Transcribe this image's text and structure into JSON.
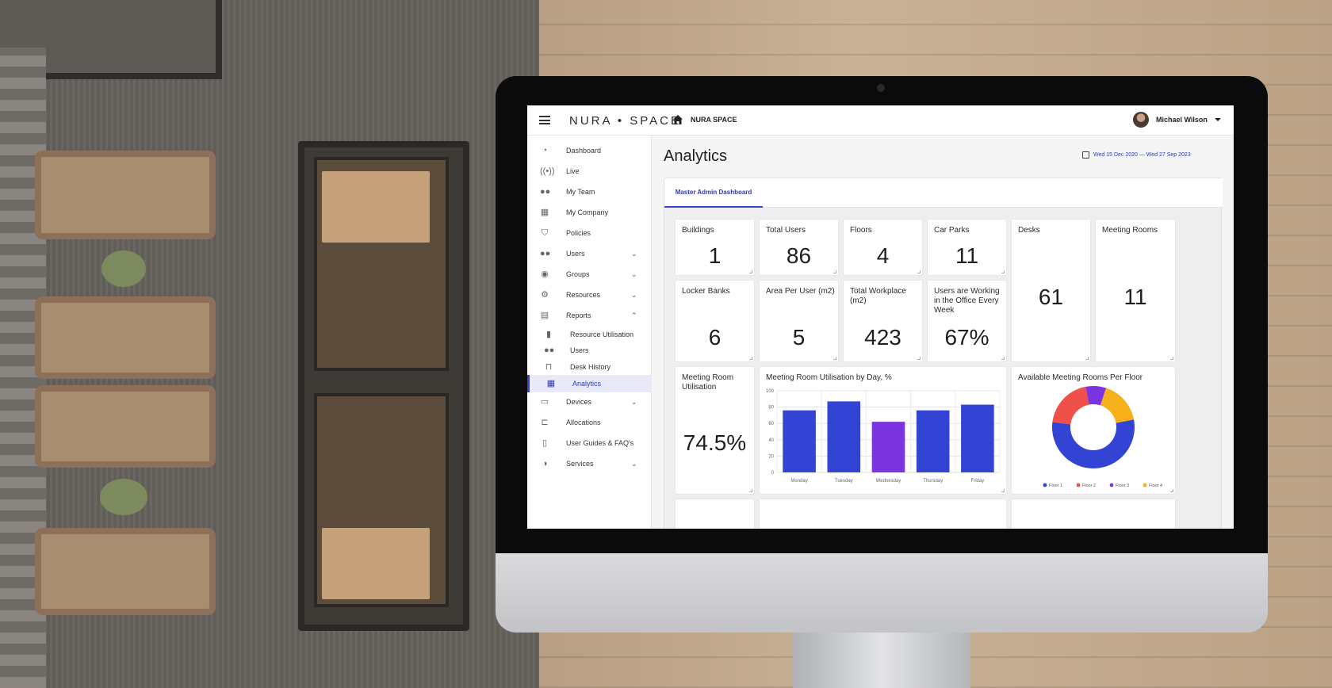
{
  "app": {
    "logo": "NURA • SPACE",
    "site_name": "NURA SPACE",
    "user_name": "Michael Wilson"
  },
  "sidebar": {
    "items": [
      {
        "label": "Dashboard",
        "icon": "dashboard-icon",
        "glyph": "◔"
      },
      {
        "label": "Live",
        "icon": "live-icon",
        "glyph": "((•))"
      },
      {
        "label": "My Team",
        "icon": "team-icon",
        "glyph": "●●"
      },
      {
        "label": "My Company",
        "icon": "company-icon",
        "glyph": "▦"
      },
      {
        "label": "Policies",
        "icon": "shield-icon",
        "glyph": "⛉"
      },
      {
        "label": "Users",
        "icon": "users-icon",
        "glyph": "●●",
        "chevron": "⌄"
      },
      {
        "label": "Groups",
        "icon": "groups-icon",
        "glyph": "◉",
        "chevron": "⌄"
      },
      {
        "label": "Resources",
        "icon": "gear-icon",
        "glyph": "⚙",
        "chevron": "⌄"
      },
      {
        "label": "Reports",
        "icon": "reports-icon",
        "glyph": "▤",
        "chevron": "⌃"
      },
      {
        "label": "Resource Utilisation",
        "icon": "bar-chart-icon",
        "glyph": "▮",
        "sub": true
      },
      {
        "label": "Users",
        "icon": "users-icon",
        "glyph": "●●",
        "sub": true
      },
      {
        "label": "Desk History",
        "icon": "desk-icon",
        "glyph": "⊓",
        "sub": true
      },
      {
        "label": "Analytics",
        "icon": "analytics-icon",
        "glyph": "▦",
        "sub": true,
        "active": true
      },
      {
        "label": "Devices",
        "icon": "devices-icon",
        "glyph": "▭",
        "chevron": "⌄"
      },
      {
        "label": "Allocations",
        "icon": "allocations-icon",
        "glyph": "⊏"
      },
      {
        "label": "User Guides & FAQ's",
        "icon": "document-icon",
        "glyph": "▯"
      },
      {
        "label": "Services",
        "icon": "services-icon",
        "glyph": "◑",
        "chevron": "⌄"
      }
    ]
  },
  "main": {
    "title": "Analytics",
    "date_range": "Wed 15 Dec 2020 — Wed 27 Sep 2023",
    "tab": "Master Admin Dashboard"
  },
  "cards": {
    "buildings": {
      "title": "Buildings",
      "value": "1"
    },
    "total_users": {
      "title": "Total Users",
      "value": "86"
    },
    "floors": {
      "title": "Floors",
      "value": "4"
    },
    "car_parks": {
      "title": "Car Parks",
      "value": "11"
    },
    "desks": {
      "title": "Desks",
      "value": "61"
    },
    "meeting_rooms": {
      "title": "Meeting Rooms",
      "value": "11"
    },
    "locker_banks": {
      "title": "Locker Banks",
      "value": "6"
    },
    "area_per_user": {
      "title": "Area Per User (m2)",
      "value": "5"
    },
    "total_workplace": {
      "title": "Total Workplace (m2)",
      "value": "423"
    },
    "users_working": {
      "title": "Users are Working in the Office Every Week",
      "value": "67%"
    },
    "meeting_room_utilisation": {
      "title": "Meeting Room Utilisation",
      "value": "74.5%"
    }
  },
  "chart_data": [
    {
      "type": "bar",
      "title": "Meeting Room Utilisation by Day, %",
      "categories": [
        "Monday",
        "Tuesday",
        "Wednesday",
        "Thursday",
        "Friday"
      ],
      "values": [
        76,
        87,
        62,
        76,
        83
      ],
      "colors": [
        "#3344d4",
        "#3344d4",
        "#7a34e0",
        "#3344d4",
        "#3344d4"
      ],
      "ylim": [
        0,
        100
      ],
      "yticks": [
        "0",
        "20",
        "40",
        "60",
        "80",
        "100"
      ],
      "grid": true
    },
    {
      "type": "pie",
      "title": "Available Meeting Rooms Per Floor",
      "labels": [
        "Floor 1",
        "Floor 2",
        "Floor 3",
        "Floor 4"
      ],
      "values": [
        55,
        20,
        8,
        17
      ],
      "colors": [
        "#3344d4",
        "#f0504a",
        "#7a34e0",
        "#f5b01a"
      ],
      "legend": "bottom"
    }
  ]
}
